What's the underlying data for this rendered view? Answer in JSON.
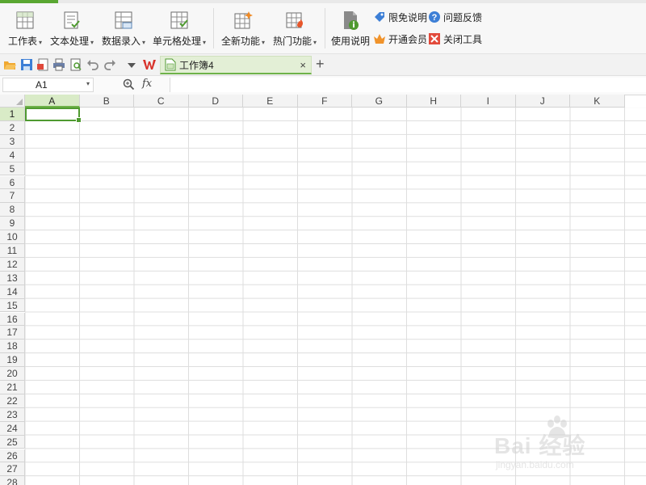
{
  "ribbon": {
    "buttons": [
      {
        "label": "工作表",
        "has_dropdown": true,
        "icon": "worksheet-icon"
      },
      {
        "label": "文本处理",
        "has_dropdown": true,
        "icon": "text-process-icon"
      },
      {
        "label": "数据录入",
        "has_dropdown": true,
        "icon": "data-entry-icon"
      },
      {
        "label": "单元格处理",
        "has_dropdown": true,
        "icon": "cell-process-icon"
      },
      {
        "label": "全新功能",
        "has_dropdown": true,
        "icon": "new-feature-icon"
      },
      {
        "label": "热门功能",
        "has_dropdown": true,
        "icon": "hot-feature-icon"
      },
      {
        "label": "使用说明",
        "has_dropdown": false,
        "icon": "help-doc-icon"
      }
    ],
    "links": {
      "limit_free": "限免说明",
      "feedback": "问题反馈",
      "open_member": "开通会员",
      "close_tool": "关闭工具"
    },
    "caret": "▾"
  },
  "tabs": {
    "document": "工作簿4",
    "close": "×",
    "add": "+"
  },
  "formula_bar": {
    "name_box": "A1",
    "fx": "fx",
    "formula": ""
  },
  "sheet": {
    "columns": [
      "A",
      "B",
      "C",
      "D",
      "E",
      "F",
      "G",
      "H",
      "I",
      "J",
      "K"
    ],
    "rows": [
      "1",
      "2",
      "3",
      "4",
      "5",
      "6",
      "7",
      "8",
      "9",
      "10",
      "11",
      "12",
      "13",
      "14",
      "15",
      "16",
      "17",
      "18",
      "19",
      "20",
      "21",
      "22",
      "23",
      "24",
      "25",
      "26",
      "27",
      "28"
    ],
    "active_cell": "A1"
  },
  "watermark": {
    "text": "Bai 经验",
    "sub": "jingyan.baidu.com"
  },
  "colors": {
    "accent": "#6fb24a",
    "selection": "#4f9a30",
    "header_bg": "#f3f3f3"
  }
}
